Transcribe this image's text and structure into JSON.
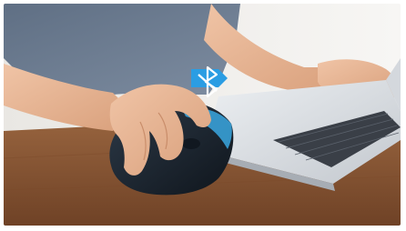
{
  "photo": {
    "subject": "hand-on-vertical-mouse-beside-laptop",
    "badge_icon": "bluetooth-icon",
    "colors": {
      "wall": "#f3f1ee",
      "shirt": "#6f7f94",
      "skin": "#e9b898",
      "desk": "#8a5632",
      "mouse_body": "#1c2530",
      "mouse_accent": "#3aa7e0",
      "laptop": "#d7dbe0",
      "keys": "#3a3f47",
      "badge": "#2b9de3"
    }
  }
}
